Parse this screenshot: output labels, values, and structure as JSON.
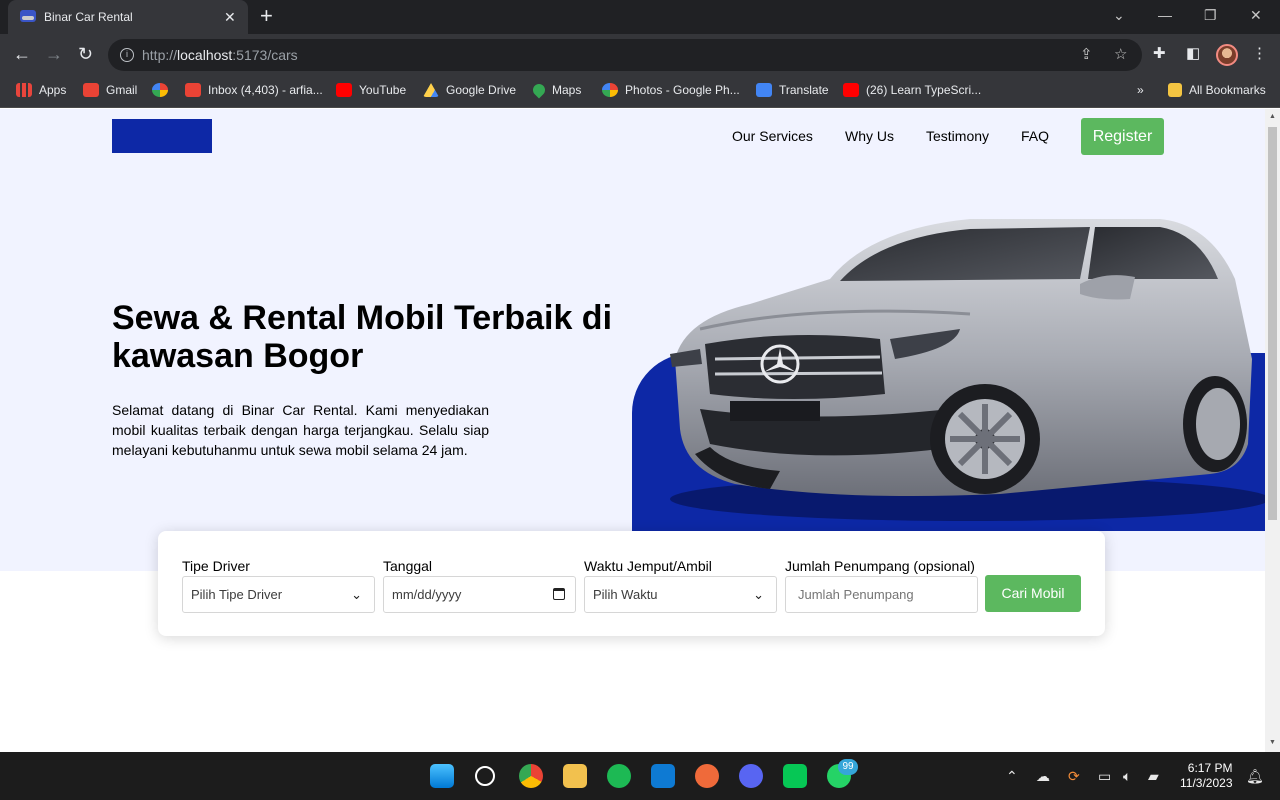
{
  "browser": {
    "tab_title": "Binar Car Rental",
    "url_prefix": "http://",
    "url_host": "localhost",
    "url_path": ":5173/cars",
    "bookmarks": [
      {
        "label": "Apps",
        "icon": "apps-grid-icon",
        "color": "#e8453c"
      },
      {
        "label": "Gmail",
        "icon": "gmail-icon",
        "color": "#ea4335"
      },
      {
        "label": "",
        "icon": "pinwheel-icon",
        "color": "#fbbc04"
      },
      {
        "label": "Inbox (4,403) - arfia...",
        "icon": "gmail-icon",
        "color": "#ea4335"
      },
      {
        "label": "YouTube",
        "icon": "youtube-icon",
        "color": "#ff0000"
      },
      {
        "label": "Google Drive",
        "icon": "drive-icon",
        "color": "#1fa463"
      },
      {
        "label": "Maps",
        "icon": "maps-icon",
        "color": "#34a853"
      },
      {
        "label": "Photos - Google Ph...",
        "icon": "photos-icon",
        "color": "#fbbc04"
      },
      {
        "label": "Translate",
        "icon": "translate-icon",
        "color": "#4285f4"
      },
      {
        "label": "(26) Learn TypeScri...",
        "icon": "youtube-icon",
        "color": "#ff0000"
      }
    ],
    "more_bookmarks": "»",
    "all_bookmarks": "All Bookmarks"
  },
  "page": {
    "nav": [
      "Our Services",
      "Why Us",
      "Testimony",
      "FAQ"
    ],
    "register": "Register",
    "headline": "Sewa & Rental Mobil Terbaik di kawasan Bogor",
    "description": "Selamat datang di Binar Car Rental. Kami menyediakan mobil kualitas terbaik dengan harga terjangkau. Selalu siap melayani kebutuhanmu untuk sewa mobil selama 24 jam.",
    "colors": {
      "brand_blue": "#0d28a6",
      "accent_green": "#5cb85f",
      "hero_bg": "#f1f3ff"
    }
  },
  "search": {
    "driver_label": "Tipe Driver",
    "driver_value": "Pilih Tipe Driver",
    "date_label": "Tanggal",
    "date_value": "mm/dd/yyyy",
    "time_label": "Waktu Jemput/Ambil",
    "time_value": "Pilih Waktu",
    "passenger_label": "Jumlah Penumpang (opsional)",
    "passenger_placeholder": "Jumlah Penumpang",
    "button": "Cari Mobil"
  },
  "taskbar": {
    "whatsapp_badge": "99",
    "time": "6:17 PM",
    "date": "11/3/2023"
  }
}
